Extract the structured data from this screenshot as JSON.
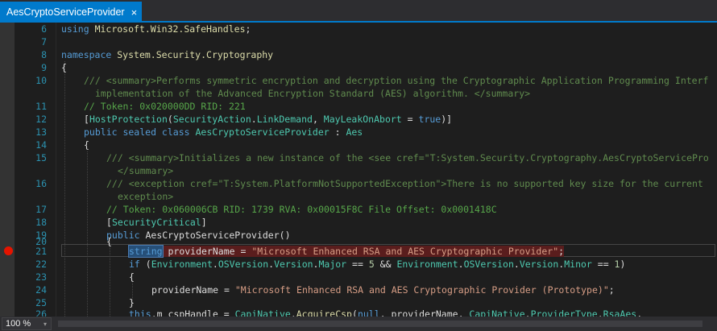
{
  "tab": {
    "title": "AesCryptoServiceProvider",
    "close_glyph": "×",
    "active_color": "#007acc"
  },
  "editor": {
    "lines": [
      {
        "num": "6"
      },
      {
        "num": "7"
      },
      {
        "num": "8"
      },
      {
        "num": "9"
      },
      {
        "num": "10"
      },
      {
        "num": ""
      },
      {
        "num": "11"
      },
      {
        "num": "12"
      },
      {
        "num": "13"
      },
      {
        "num": "14"
      },
      {
        "num": "15"
      },
      {
        "num": ""
      },
      {
        "num": "16"
      },
      {
        "num": ""
      },
      {
        "num": "17"
      },
      {
        "num": "18"
      },
      {
        "num": "19"
      },
      {
        "num": "20"
      },
      {
        "num": "21"
      },
      {
        "num": "22"
      },
      {
        "num": "23"
      },
      {
        "num": "24"
      },
      {
        "num": "25"
      },
      {
        "num": "26"
      }
    ],
    "breakpoint_line": "21"
  },
  "code": {
    "l6": {
      "kw": "using",
      "ns": "Microsoft.Win32.SafeHandles",
      "end": ";"
    },
    "l8": {
      "kw": "namespace",
      "ns": "System.Security.Cryptography"
    },
    "l9": "{",
    "l10a": "/// <summary>Performs symmetric encryption and decryption using the Cryptographic Application Programming Interf",
    "l10b": "implementation of the Advanced Encryption Standard (AES) algorithm. </summary>",
    "l11": "// Token: 0x020000DD RID: 221",
    "l12": {
      "open": "[",
      "attr": "HostProtection",
      "p1": "(",
      "t1": "SecurityAction",
      "dot": ".",
      "m1": "LinkDemand",
      "comma": ", ",
      "m2": "MayLeakOnAbort",
      "eq": " = ",
      "kw": "true",
      "close": ")]"
    },
    "l13": {
      "kw": "public sealed class",
      "ty": "AesCryptoServiceProvider",
      "colon": " : ",
      "base": "Aes"
    },
    "l14": "{",
    "l15a_pre": "/// <summary>",
    "l15a_text": "Initializes a new instance of the ",
    "l15a_tag": "<see cref=\"T:System.Security.Cryptography.AesCryptoServicePro",
    "l15b": "</summary>",
    "l16a_pre": "/// <exception cref=\"T:System.PlatformNotSupportedException\">",
    "l16a_text": "There is no supported key size for the current",
    "l16b": "exception>",
    "l17": "// Token: 0x060006CB RID: 1739 RVA: 0x00015F8C File Offset: 0x0001418C",
    "l18": {
      "open": "[",
      "attr": "SecurityCritical",
      "close": "]"
    },
    "l19": {
      "kw": "public",
      "name": "AesCryptoServiceProvider",
      "paren": "()"
    },
    "l20": "{",
    "l21": {
      "kw": "string",
      "rest": " providerName = ",
      "str": "\"Microsoft Enhanced RSA and AES Cryptographic Provider\"",
      "end": ";"
    },
    "l22": {
      "kw": "if",
      "p": " (",
      "t1": "Environment",
      "d1": ".",
      "t2": "OSVersion",
      "d2": ".",
      "t3": "Version",
      "d3": ".",
      "t4": "Major",
      "eq1": " == ",
      "n1": "5",
      "and": " && ",
      "t5": "Environment",
      "d4": ".",
      "t6": "OSVersion",
      "d5": ".",
      "t7": "Version",
      "d6": ".",
      "t8": "Minor",
      "eq2": " == ",
      "n2": "1",
      "cp": ")"
    },
    "l23": "{",
    "l24": {
      "var": "providerName = ",
      "str": "\"Microsoft Enhanced RSA and AES Cryptographic Provider (Prototype)\"",
      "end": ";"
    },
    "l25": "}",
    "l26": {
      "kw": "this",
      "a": ".m_cspHandle = ",
      "t1": "CapiNative",
      "d1": ".",
      "m1": "AcquireCsp",
      "p": "(",
      "kw2": "null",
      "b": ", providerName, ",
      "t2": "CapiNative",
      "d2": ".",
      "t3": "ProviderType",
      "d3": ".",
      "t4": "RsaAes",
      "c": ","
    }
  },
  "status": {
    "zoom": "100 %",
    "zoom_dropdown": "▾"
  },
  "colors": {
    "background": "#1e1e1e",
    "keyword": "#569cd6",
    "type": "#4ec9b0",
    "comment": "#57a64a",
    "string": "#d69d85",
    "line_number": "#2b91af",
    "breakpoint": "#e51400"
  }
}
